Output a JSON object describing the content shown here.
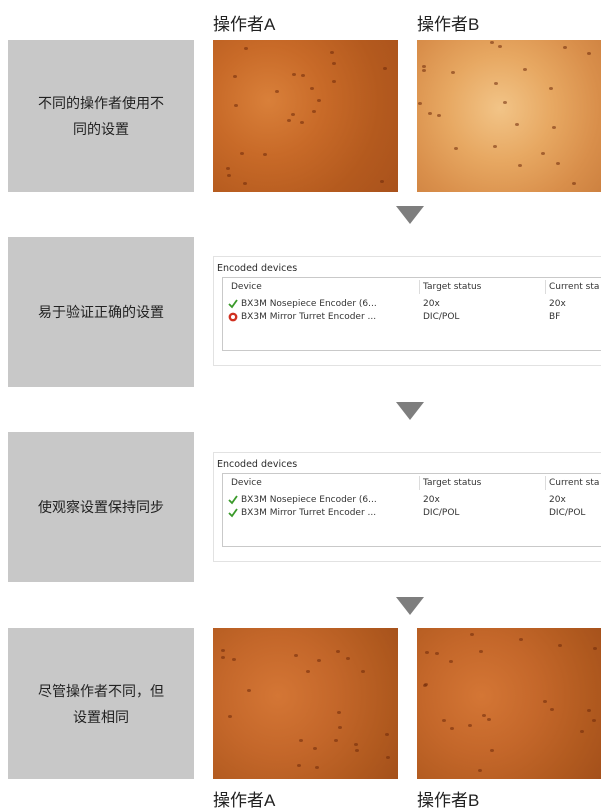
{
  "top_labels": {
    "operator_a": "操作者A",
    "operator_b": "操作者B"
  },
  "bottom_labels": {
    "operator_a": "操作者A",
    "operator_b": "操作者B"
  },
  "steps": [
    {
      "line1": "不同的操作者使用不",
      "line2": "同的设置"
    },
    {
      "line1": "易于验证正确的设置"
    },
    {
      "line1": "使观察设置保持同步"
    },
    {
      "line1": "尽管操作者不同，但",
      "line2": "设置相同"
    }
  ],
  "panel_1": {
    "title": "Encoded devices",
    "headers": [
      "Device",
      "Target status",
      "Current sta"
    ],
    "rows": [
      {
        "status_icon": "check-icon",
        "device": "BX3M Nosepiece Encoder (6...",
        "target": "20x",
        "current": "20x"
      },
      {
        "status_icon": "error-icon",
        "device": "BX3M Mirror Turret Encoder ...",
        "target": "DIC/POL",
        "current": "BF"
      }
    ]
  },
  "panel_2": {
    "title": "Encoded devices",
    "headers": [
      "Device",
      "Target status",
      "Current sta"
    ],
    "rows": [
      {
        "status_icon": "check-icon",
        "device": "BX3M Nosepiece Encoder (6...",
        "target": "20x",
        "current": "20x"
      },
      {
        "status_icon": "check-icon",
        "device": "BX3M Mirror Turret Encoder ...",
        "target": "DIC/POL",
        "current": "DIC/POL"
      }
    ]
  },
  "colors": {
    "grey_box": "#c8c8c8",
    "arrow": "#7e7e7e",
    "check": "#3a9a2a",
    "error": "#d03020"
  }
}
